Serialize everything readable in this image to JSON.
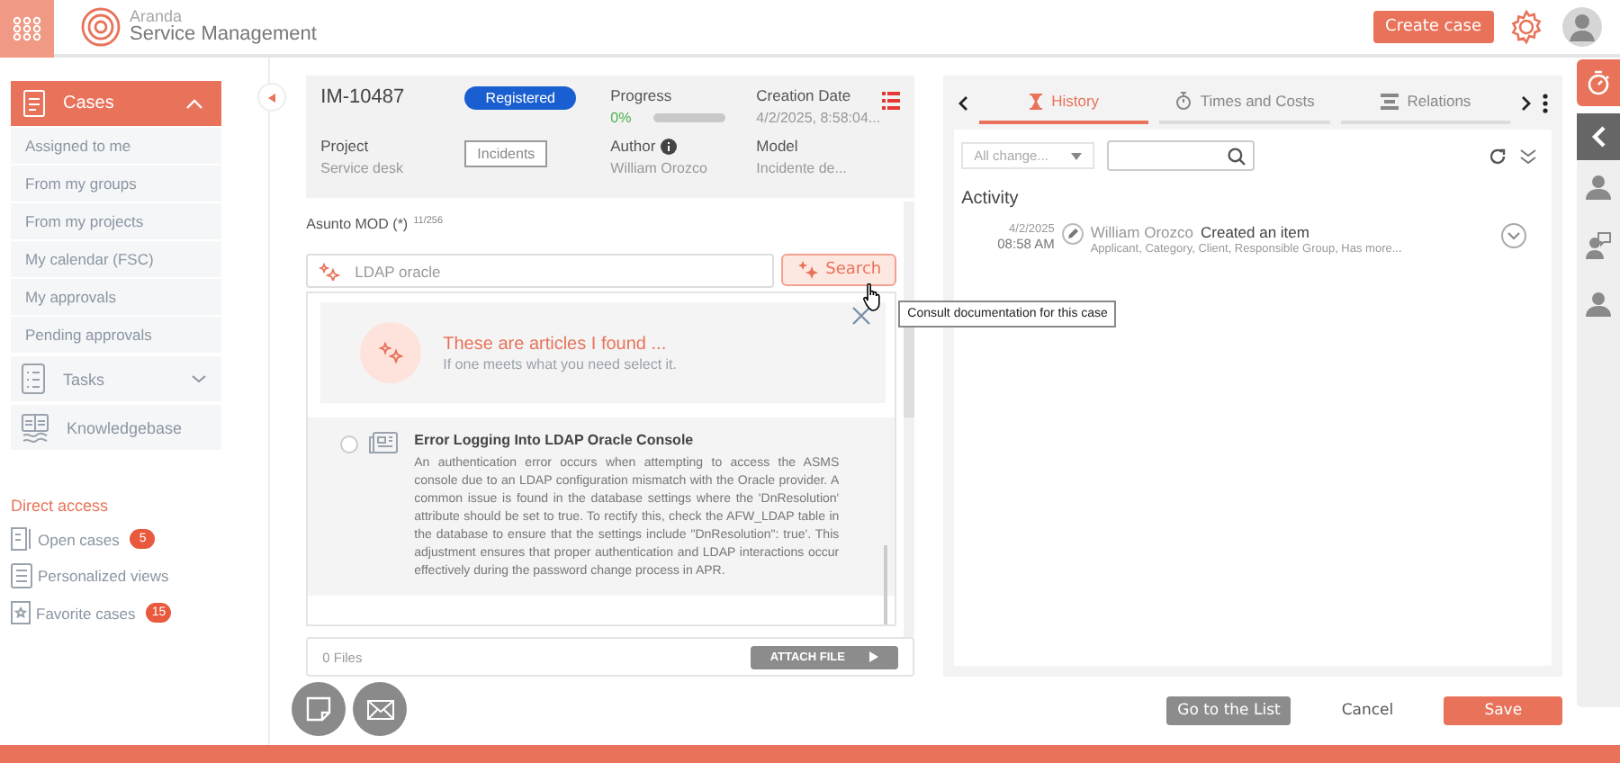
{
  "header": {
    "brand_top": "Aranda",
    "brand": "Service Management",
    "create_button": "Create case"
  },
  "sidebar": {
    "cases": {
      "label": "Cases",
      "expanded": true
    },
    "items": [
      {
        "label": "Assigned to me",
        "selected": false
      },
      {
        "label": "From my groups",
        "selected": false
      },
      {
        "label": "From my projects",
        "selected": false
      },
      {
        "label": "My calendar (FSC)",
        "selected": false
      },
      {
        "label": "My approvals",
        "selected": false
      },
      {
        "label": "Pending approvals",
        "selected": false
      }
    ],
    "groups": [
      {
        "kind": "tasks",
        "label": "Tasks",
        "expanded": false
      },
      {
        "kind": "knowledge",
        "label": "Knowledgebase"
      }
    ],
    "direct_access": {
      "title": "Direct access",
      "items": [
        {
          "kind": "open",
          "label": "Open cases",
          "count": "5"
        },
        {
          "kind": "views",
          "label": "Personalized views"
        },
        {
          "kind": "favorite",
          "label": "Favorite cases",
          "count": "15"
        }
      ]
    }
  },
  "case": {
    "id": "IM-10487",
    "status": "Registered",
    "progress_label": "Progress",
    "percent": "0%",
    "level": 0,
    "creation_label": "Creation Date",
    "creation_value": "4/2/2025, 8:58:04...",
    "project_label": "Project",
    "project_value": "Service desk",
    "type": "Incidents",
    "author_label": "Author",
    "author_value": "William Orozco",
    "model_label": "Model",
    "model_value": "Incidente de..."
  },
  "subject": {
    "label": "Asunto MOD (*)",
    "counter": "11/256",
    "value": "LDAP oracle",
    "button": "Search",
    "tooltip": "Consult documentation for this case"
  },
  "suggestions": {
    "title": "These are articles I found ...",
    "subtitle": "If one meets what you need select it.",
    "articles": [
      {
        "title": "Error Logging Into LDAP Oracle Console",
        "selected": false,
        "body": "An authentication error occurs when attempting to access the ASMS console due to an LDAP configuration mismatch with the Oracle provider. A common issue is found in the database settings where the 'DnResolution' attribute should be set to true. To rectify this, check the AFW_LDAP table in the database to ensure that the settings include \"DnResolution\": true'. This adjustment ensures that proper authentication and LDAP interactions occur effectively during the password change process in APR."
      }
    ]
  },
  "files": {
    "count": "0 Files",
    "button": "ATTACH FILE"
  },
  "history": {
    "tabs": [
      {
        "kind": "history",
        "label": "History",
        "selected": true
      },
      {
        "kind": "times",
        "label": "Times and Costs",
        "selected": false
      },
      {
        "kind": "relations",
        "label": "Relations",
        "selected": false
      }
    ],
    "filter": "All change...",
    "activity_title": "Activity",
    "entries": [
      {
        "date": "4/2/2025",
        "time": "08:58 AM",
        "user": "William Orozco",
        "action": "Created an item",
        "details": "Applicant, Category, Client, Responsible Group, Has more..."
      }
    ]
  },
  "actions": {
    "list_button": "Go to the List",
    "cancel_button": "Cancel",
    "save_button": "Save"
  }
}
